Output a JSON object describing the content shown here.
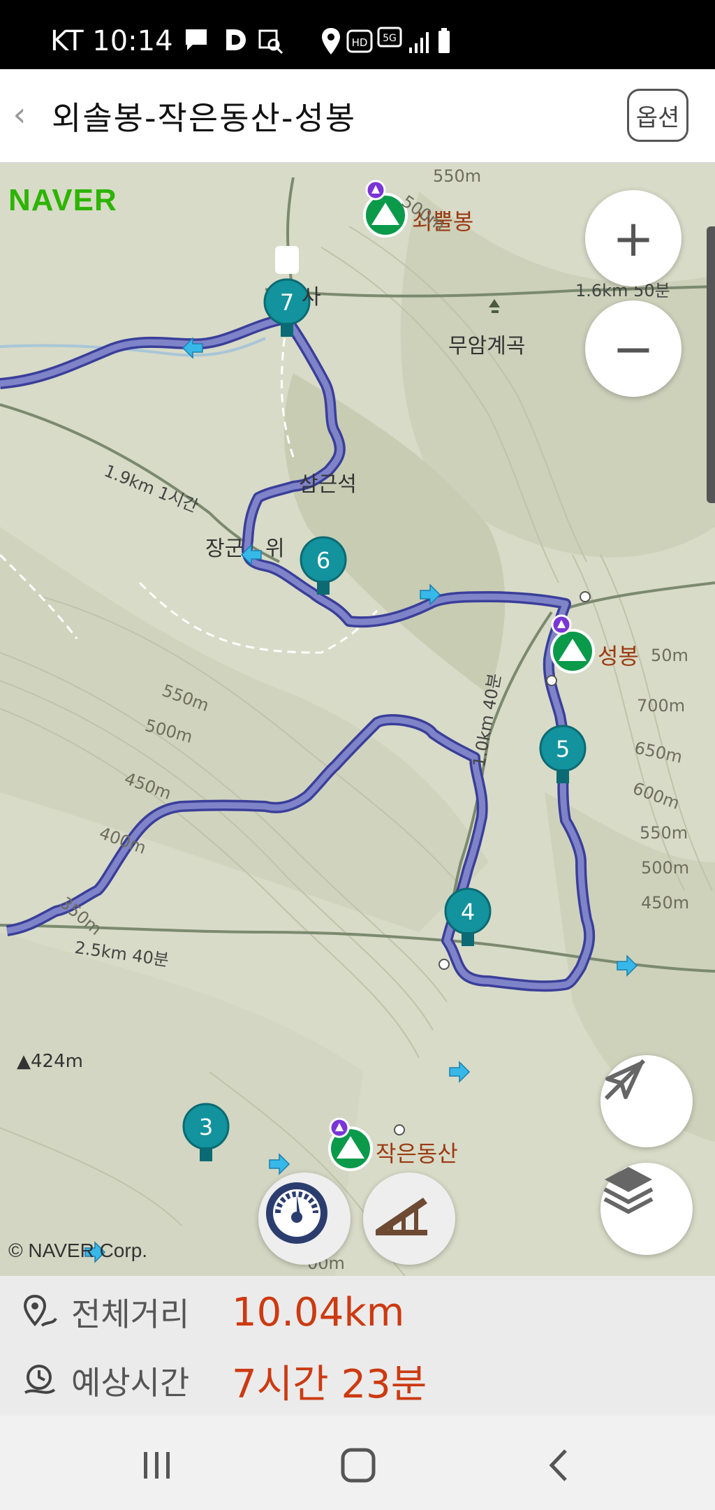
{
  "status_bar": {
    "carrier_time": "KT 10:14",
    "icons": [
      "chat-bubble-icon",
      "d-icon",
      "image-search-icon",
      "location-icon",
      "hd-icon",
      "5g-icon",
      "signal-icon",
      "battery-icon"
    ]
  },
  "header": {
    "back_label": "‹",
    "title": "외솔봉-작은동산-성봉",
    "options_label": "옵션"
  },
  "map": {
    "logo": "NAVER",
    "copyright": "© NAVER Corp.",
    "zoom_in": "+",
    "zoom_out": "−",
    "labels": {
      "peak_soe": "쇠뿔봉",
      "temple": "사",
      "valley": "무암계곡",
      "rock": "삼근석",
      "jang": "장군",
      "wi": "위",
      "peak_seong": "성봉",
      "peak_jakeun": "작은동산",
      "elev_424": "▲424m"
    },
    "trail_labels": {
      "t1": "1.6km 50분",
      "t2": "1.9km 1시간",
      "t3": "1.0km 40분",
      "t4": "2.5km 40분"
    },
    "contours": {
      "c550a": "550m",
      "c500a": "500m",
      "c550b": "550m",
      "c500b": "500m",
      "c450a": "450m",
      "c400a": "400m",
      "c350a": "350m",
      "c50": "50m",
      "c700": "700m",
      "c650": "650m",
      "c600": "600m",
      "c550c": "550m",
      "c500c": "500m",
      "c450c": "450m",
      "c00": "00m"
    },
    "waypoints": [
      "7",
      "6",
      "5",
      "4",
      "3"
    ],
    "colors": {
      "route": "#5b5fa6",
      "waypoint": "#12939e",
      "peak": "#0a9a4a",
      "brand": "#2db400"
    }
  },
  "summary": {
    "distance_label": "전체거리",
    "distance_value": "10.04km",
    "time_label": "예상시간",
    "time_value": "7시간 23분"
  },
  "navbar": [
    "recent-apps",
    "home",
    "back"
  ]
}
